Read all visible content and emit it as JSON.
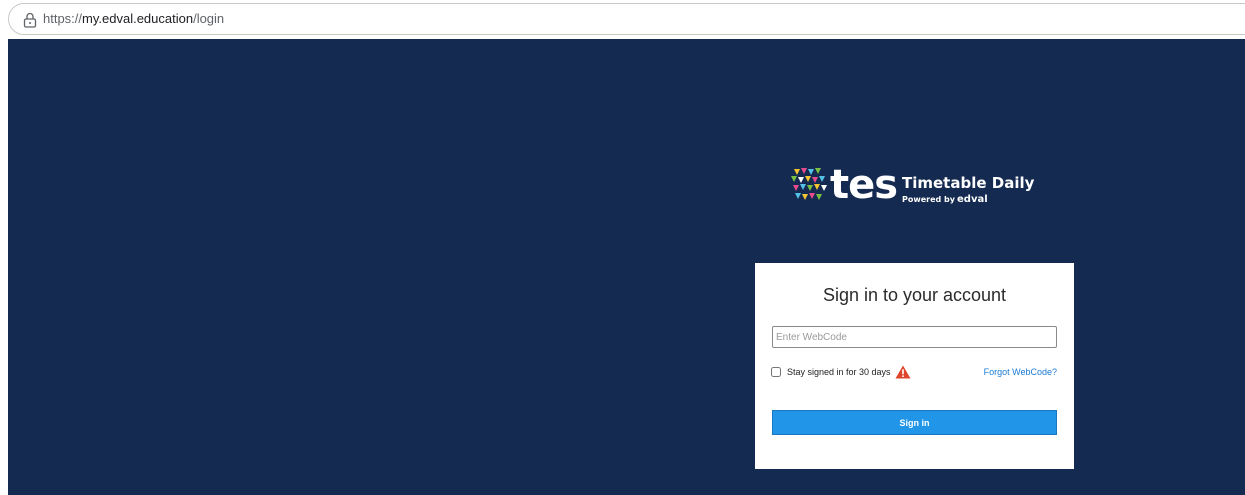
{
  "browser": {
    "url_scheme": "https://",
    "url_host": "my.edval.education",
    "url_path": "/login"
  },
  "brand": {
    "logo_text": "tes",
    "product_name": "Timetable Daily",
    "powered_by": "Powered by",
    "powered_brand": "edval"
  },
  "login": {
    "title": "Sign in to your account",
    "webcode_placeholder": "Enter WebCode",
    "webcode_value": "",
    "stay_signed_in_label": "Stay signed in for 30 days",
    "stay_signed_in_checked": false,
    "forgot_link": "Forgot WebCode?",
    "signin_button": "Sign in"
  },
  "colors": {
    "page_background": "#142a50",
    "button": "#2196e8",
    "link": "#1a7ad6",
    "warning": "#e0452b"
  },
  "icons": {
    "lock": "lock-icon",
    "warning": "warning-icon",
    "logo_mark": "tes-logo-mark-icon"
  }
}
